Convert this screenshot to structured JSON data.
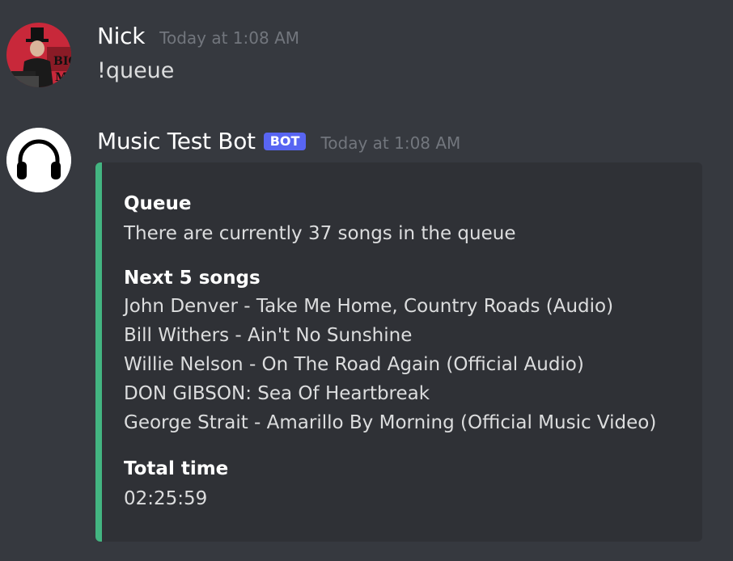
{
  "messages": [
    {
      "author": "Nick",
      "timestamp": "Today at 1:08 AM",
      "avatar_icon": "user-avatar-image",
      "content": "!queue"
    },
    {
      "author": "Music Test Bot",
      "badge": "BOT",
      "timestamp": "Today at 1:08 AM",
      "avatar_icon": "headphones-icon",
      "embed": {
        "accent_color": "#43b581",
        "fields": [
          {
            "name": "Queue",
            "value": "There are currently 37 songs in the queue"
          },
          {
            "name": "Next 5 songs",
            "values": [
              "John Denver - Take Me Home, Country Roads (Audio)",
              "Bill Withers - Ain't No Sunshine",
              "Willie Nelson - On The Road Again (Official Audio)",
              "DON GIBSON: Sea Of Heartbreak",
              "George Strait - Amarillo By Morning (Official Music Video)"
            ]
          },
          {
            "name": "Total time",
            "value": "02:25:59"
          }
        ]
      }
    }
  ],
  "colors": {
    "background": "#36393f",
    "embed_background": "#2f3136",
    "bot_badge": "#5865f2",
    "timestamp": "#72767d"
  }
}
